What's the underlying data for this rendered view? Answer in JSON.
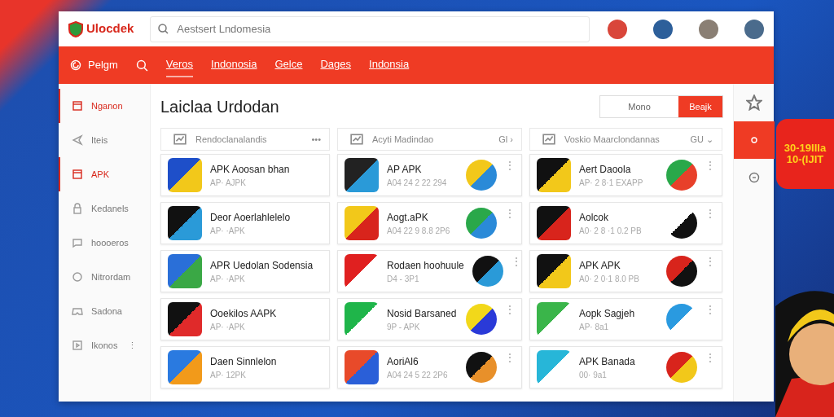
{
  "header": {
    "logo": "Ulocdek",
    "search": {
      "placeholder": "Aestsert Lndomesia"
    },
    "avatars": [
      {
        "color": "#d9463a"
      },
      {
        "color": "#2d5f9a"
      },
      {
        "color": "#8a7f74"
      },
      {
        "color": "#4a6b8c"
      }
    ]
  },
  "nav": {
    "brand": "Pelgm",
    "items": [
      {
        "label": "Veros",
        "selected": true
      },
      {
        "label": "Indonosia",
        "selected": false
      },
      {
        "label": "Gelce",
        "selected": false
      },
      {
        "label": "Dages",
        "selected": false
      },
      {
        "label": "Indonsia",
        "selected": false
      }
    ]
  },
  "sidebar": {
    "items": [
      {
        "label": "Nganon",
        "selected": true
      },
      {
        "label": "Iteis",
        "selected": false
      },
      {
        "label": "APK",
        "selected": true
      },
      {
        "label": "Kedanels",
        "selected": false
      },
      {
        "label": "hoooeros",
        "selected": false
      },
      {
        "label": "Nitrordam",
        "selected": false
      },
      {
        "label": "Sadona",
        "selected": false
      },
      {
        "label": "Ikonos",
        "selected": false,
        "menu": "⋮"
      }
    ]
  },
  "main": {
    "title": "Laiclaa Urdodan",
    "toggle": [
      {
        "label": "Mono",
        "selected": false
      },
      {
        "label": "Beajk",
        "selected": true
      }
    ],
    "columns": [
      {
        "title": "Rendoclanalandis",
        "action": "•••",
        "apps": [
          {
            "name": "APK Aoosan bhan",
            "meta": "AP· AJPK"
          },
          {
            "name": "Deor Aoerlahlelelo",
            "meta": "AP· ·APK"
          },
          {
            "name": "APR Uedolan Sodensia",
            "meta": "AP· ·APK"
          },
          {
            "name": "Ooekilos AAPK",
            "meta": "AP· ·APK"
          },
          {
            "name": "Daen Sinnlelon",
            "meta": "AP· 12PK"
          }
        ]
      },
      {
        "title": "Acyti Madindao",
        "action": "Gl ›",
        "apps": [
          {
            "name": "AP APK",
            "meta": "A04 24 2 22 294",
            "menu": "⋮"
          },
          {
            "name": "Aogt.aPK",
            "meta": "A04 22 9 8.8 2P6",
            "menu": "⋮"
          },
          {
            "name": "Rodaen hoohuule",
            "meta": "D4 - 3P1",
            "menu": "⋮"
          },
          {
            "name": "Nosid Barsaned",
            "meta": "9P - APK",
            "menu": "⋮"
          },
          {
            "name": "AoriAl6",
            "meta": "A04 24 5 22 2P6",
            "menu": "⋮"
          }
        ]
      },
      {
        "title": "Voskio Maarclondannas",
        "action": "GU ⌄",
        "apps": [
          {
            "name": "Aert Daoola",
            "meta": "AP· 2 8·1 EXAPP",
            "menu": "⋮"
          },
          {
            "name": "Aolcok",
            "meta": "A0· 2 8 ·1 0.2 PB",
            "menu": "⋮"
          },
          {
            "name": "APK APK",
            "meta": "A0· 2 0·1 8.0 PB",
            "menu": "⋮"
          },
          {
            "name": "Aopk Sagjeh",
            "meta": "AP· 8a1",
            "menu": "⋮"
          },
          {
            "name": "APK Banada",
            "meta": "00· 9a1",
            "menu": "⋮"
          }
        ]
      }
    ]
  },
  "rail": [
    {
      "selected": false
    },
    {
      "selected": true
    },
    {
      "selected": false
    }
  ],
  "promo": {
    "lines": [
      "30-19IIIa",
      "10-(IJIT"
    ]
  }
}
